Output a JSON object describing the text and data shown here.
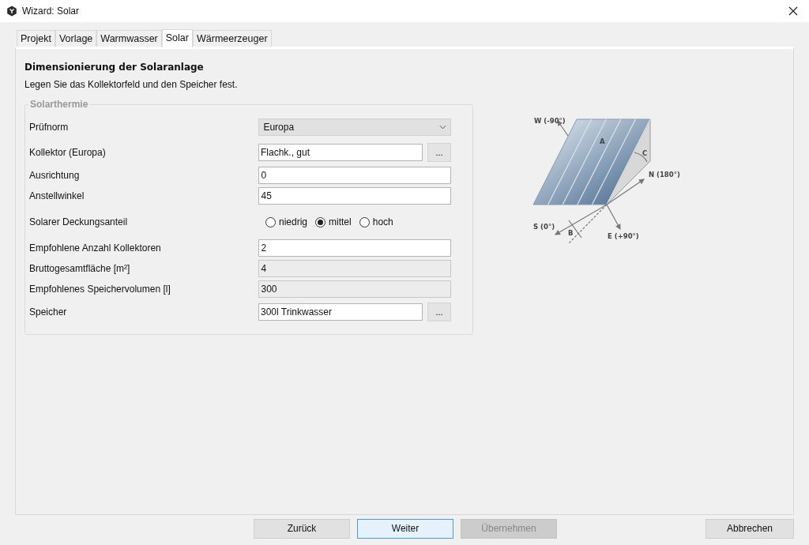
{
  "window": {
    "title": "Wizard: Solar"
  },
  "tabs": [
    {
      "label": "Projekt",
      "selected": false
    },
    {
      "label": "Vorlage",
      "selected": false
    },
    {
      "label": "Warmwasser",
      "selected": false
    },
    {
      "label": "Solar",
      "selected": true
    },
    {
      "label": "Wärmeerzeuger",
      "selected": false
    }
  ],
  "heading": "Dimensionierung der Solaranlage",
  "description": "Legen Sie das Kollektorfeld und den Speicher fest.",
  "group": {
    "title": "Solarthermie",
    "rows": [
      {
        "kind": "combo",
        "label": "Prüfnorm",
        "value": "Europa"
      },
      {
        "kind": "browse",
        "label": "Kollektor (Europa)",
        "value": "Flachk., gut",
        "button": "..."
      },
      {
        "kind": "text",
        "label": "Ausrichtung",
        "value": "0",
        "disabled": false
      },
      {
        "kind": "text",
        "label": "Anstellwinkel",
        "value": "45",
        "disabled": false
      },
      {
        "kind": "radio",
        "label": "Solarer Deckungsanteil",
        "options": [
          {
            "label": "niedrig",
            "selected": false
          },
          {
            "label": "mittel",
            "selected": true
          },
          {
            "label": "hoch",
            "selected": false
          }
        ]
      },
      {
        "kind": "text",
        "label": "Empfohlene Anzahl Kollektoren",
        "value": "2",
        "disabled": false
      },
      {
        "kind": "text",
        "label": "Bruttogesamtfläche [m²]",
        "value": "4",
        "disabled": true
      },
      {
        "kind": "text",
        "label": "Empfohlenes Speichervolumen [l]",
        "value": "300",
        "disabled": true
      },
      {
        "kind": "browse",
        "label": "Speicher",
        "value": "300l Trinkwasser",
        "button": "..."
      }
    ]
  },
  "diagram": {
    "labels": [
      "W (-90°)",
      "A",
      "C",
      "N (180°)",
      "S (0°)",
      "B",
      "E (+90°)"
    ]
  },
  "buttons": [
    {
      "label": "Zurück",
      "kind": "normal",
      "disabled": false
    },
    {
      "label": "Weiter",
      "kind": "default",
      "disabled": false
    },
    {
      "label": "Übernehmen",
      "kind": "normal",
      "disabled": true
    },
    {
      "label": "Abbrechen",
      "kind": "cancel",
      "disabled": false
    }
  ]
}
